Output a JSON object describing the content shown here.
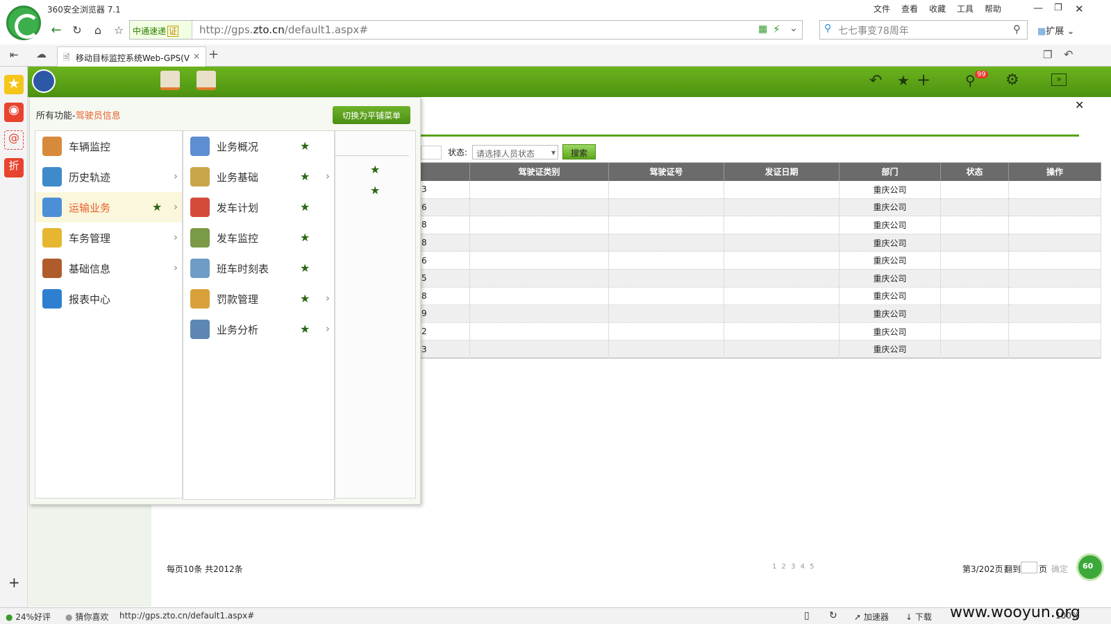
{
  "browser": {
    "title": "360安全浏览器 7.1",
    "menu": [
      "文件",
      "查看",
      "收藏",
      "工具",
      "帮助"
    ],
    "ssl_label": "中通速递",
    "ssl_badge": "证",
    "url_host": "http://gps.",
    "url_domain": "zto.cn",
    "url_path": "/default1.aspx#",
    "search_placeholder": "七七事变78周年",
    "ext_label": "扩展",
    "tab_title": "移动目标监控系统Web-GPS(V"
  },
  "toolbar": {
    "badge": "99"
  },
  "menu": {
    "breadcrumb_prefix": "所有功能-",
    "breadcrumb_current": "驾驶员信息",
    "switch_button": "切换为平铺菜单",
    "level1": [
      {
        "label": "车辆监控",
        "color": "#d88a3c"
      },
      {
        "label": "历史轨迹",
        "color": "#3e8acb"
      },
      {
        "label": "运输业务",
        "color": "#4d8fd6"
      },
      {
        "label": "车务管理",
        "color": "#e6b631"
      },
      {
        "label": "基础信息",
        "color": "#b05b2c"
      },
      {
        "label": "报表中心",
        "color": "#2f7fd0"
      }
    ],
    "level2": [
      {
        "label": "业务概况",
        "color": "#5c8ed1"
      },
      {
        "label": "业务基础",
        "color": "#c9a54a"
      },
      {
        "label": "发车计划",
        "color": "#d44b3b"
      },
      {
        "label": "发车监控",
        "color": "#7a9a47"
      },
      {
        "label": "班车时刻表",
        "color": "#6f9cc7"
      },
      {
        "label": "罚款管理",
        "color": "#d9a03a"
      },
      {
        "label": "业务分析",
        "color": "#5d86b5"
      }
    ]
  },
  "filter": {
    "status_label": "状态:",
    "status_placeholder": "请选择人员状态",
    "search_button": "搜索"
  },
  "table": {
    "headers": [
      "驾驶证类别",
      "驾驶证号",
      "发证日期",
      "部门",
      "状态",
      "操作"
    ],
    "rows": [
      {
        "c": "3",
        "dept": "重庆公司"
      },
      {
        "c": "6",
        "dept": "重庆公司"
      },
      {
        "c": "8",
        "dept": "重庆公司"
      },
      {
        "c": "8",
        "dept": "重庆公司"
      },
      {
        "c": "6",
        "dept": "重庆公司"
      },
      {
        "c": "5",
        "dept": "重庆公司"
      },
      {
        "c": "8",
        "dept": "重庆公司"
      },
      {
        "c": "9",
        "dept": "重庆公司"
      },
      {
        "c": "2",
        "dept": "重庆公司"
      },
      {
        "c": "3",
        "dept": "重庆公司"
      }
    ]
  },
  "pager": {
    "summary": "每页10条  共2012条",
    "pages": "1 2 3 4 5",
    "current": "第3/202页",
    "goto": "翻到",
    "page_unit": "页",
    "confirm": "确定",
    "badge": "60"
  },
  "statusbar": {
    "rating": "24%好评",
    "guess": "猜你喜欢",
    "url": "http://gps.zto.cn/default1.aspx#",
    "accelerator": "加速器",
    "download": "下载",
    "zoom": "100%",
    "watermark": "www.wooyun.org"
  }
}
